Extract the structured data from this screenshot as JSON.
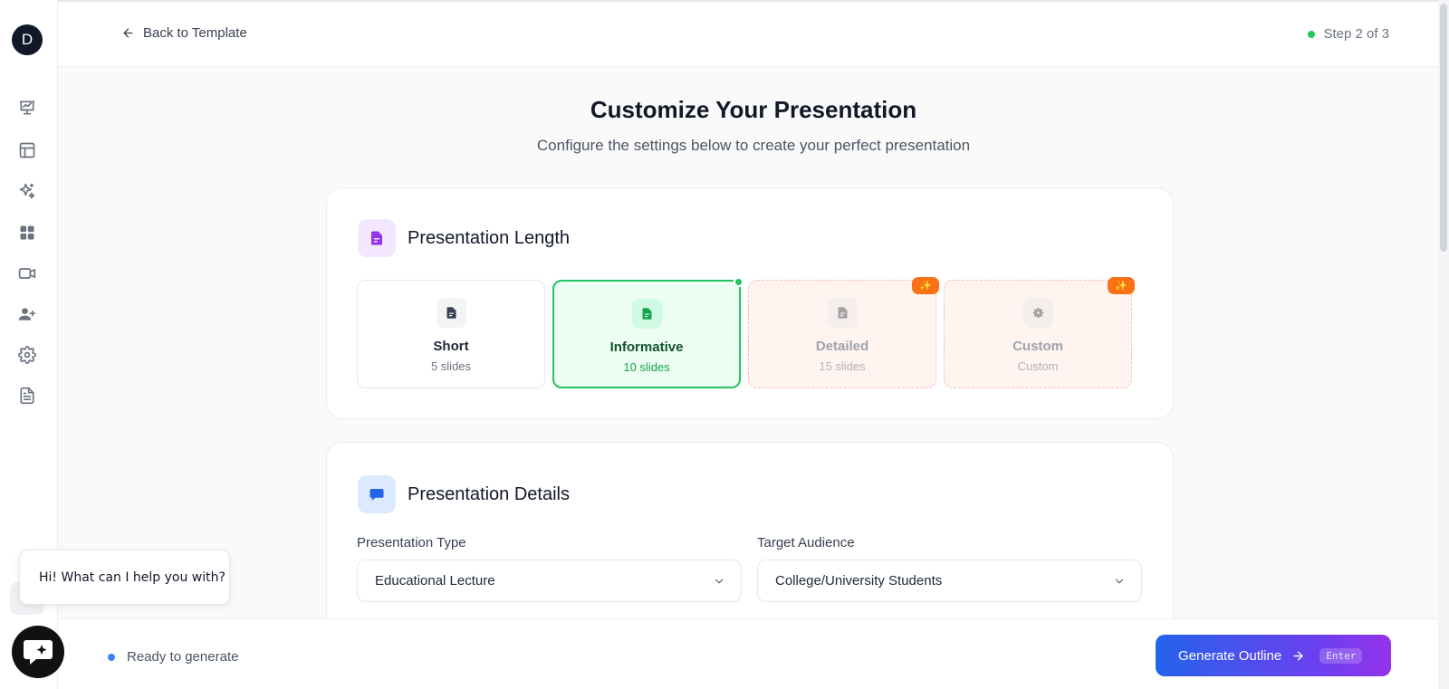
{
  "sidebar": {
    "avatar_letter": "D",
    "icons": [
      "presentation-chart-icon",
      "layout-template-icon",
      "sparkles-icon",
      "apps-grid-icon",
      "video-icon",
      "user-plus-icon",
      "settings-gear-icon",
      "document-icon"
    ]
  },
  "header": {
    "back_label": "Back to Template",
    "step_label": "Step 2 of 3"
  },
  "main": {
    "title": "Customize Your Presentation",
    "subtitle": "Configure the settings below to create your perfect presentation"
  },
  "length": {
    "title": "Presentation Length",
    "options": [
      {
        "label": "Short",
        "sub": "5 slides",
        "state": "default"
      },
      {
        "label": "Informative",
        "sub": "10 slides",
        "state": "selected"
      },
      {
        "label": "Detailed",
        "sub": "15 slides",
        "state": "locked"
      },
      {
        "label": "Custom",
        "sub": "Custom",
        "state": "locked"
      }
    ],
    "badge": "✨"
  },
  "details": {
    "title": "Presentation Details",
    "type_label": "Presentation Type",
    "type_value": "Educational Lecture",
    "audience_label": "Target Audience",
    "audience_value": "College/University Students"
  },
  "footer": {
    "status": "Ready to generate",
    "generate_label": "Generate Outline",
    "shortcut": "Enter"
  },
  "chat": {
    "greeting": "Hi! What can I help you with?"
  },
  "colors": {
    "accent_green": "#22c55e",
    "accent_blue": "#2563eb",
    "accent_purple": "#9333ea",
    "badge_orange": "#f97316"
  }
}
